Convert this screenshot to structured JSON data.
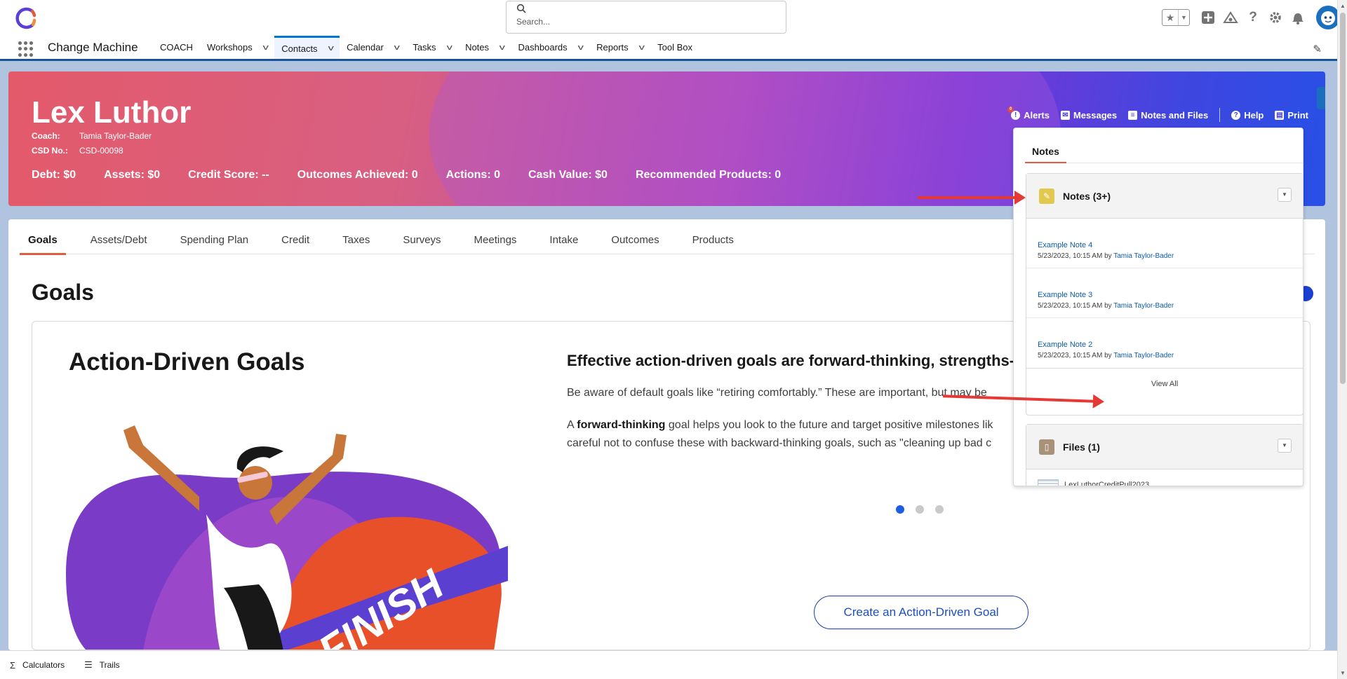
{
  "header": {
    "search_placeholder": "Search..."
  },
  "nav": {
    "app_name": "Change Machine",
    "items": [
      {
        "label": "COACH",
        "has_menu": false
      },
      {
        "label": "Workshops",
        "has_menu": true
      },
      {
        "label": "Contacts",
        "has_menu": true,
        "active": true
      },
      {
        "label": "Calendar",
        "has_menu": true
      },
      {
        "label": "Tasks",
        "has_menu": true
      },
      {
        "label": "Notes",
        "has_menu": true
      },
      {
        "label": "Dashboards",
        "has_menu": true
      },
      {
        "label": "Reports",
        "has_menu": true
      },
      {
        "label": "Tool Box",
        "has_menu": false
      }
    ]
  },
  "contact": {
    "name": "Lex Luthor",
    "coach_label": "Coach:",
    "coach": "Tamia Taylor-Bader",
    "csd_label": "CSD No.:",
    "csd": "CSD-00098",
    "stats": [
      "Debt: $0",
      "Assets: $0",
      "Credit Score: --",
      "Outcomes Achieved: 0",
      "Actions: 0",
      "Cash Value: $0",
      "Recommended Products: 0"
    ]
  },
  "hero_actions": {
    "alerts": "Alerts",
    "alerts_badge": "0",
    "messages": "Messages",
    "notes_files": "Notes and Files",
    "help": "Help",
    "print": "Print"
  },
  "tabs": [
    "Goals",
    "Assets/Debt",
    "Spending Plan",
    "Credit",
    "Taxes",
    "Surveys",
    "Meetings",
    "Intake",
    "Outcomes",
    "Products"
  ],
  "main": {
    "title": "Goals",
    "card_title": "Action-Driven Goals",
    "finish_text": "FINISH",
    "heading": "Effective action-driven goals are forward-thinking, strengths-b",
    "para1": "Be aware of default goals like “retiring comfortably.” These are important, but may be",
    "para2_pre": "A ",
    "para2_bold": "forward-thinking",
    "para2_post": " goal helps you look to the future and target positive milestones lik",
    "para3": "careful not to confuse these with backward-thinking goals, such as \"cleaning up bad c",
    "carousel_pages": 3,
    "carousel_active": 1,
    "create_button": "Create an Action-Driven Goal"
  },
  "panel": {
    "tab": "Notes",
    "notes_section": "Notes (3+)",
    "notes": [
      {
        "title": "Example Note 4",
        "meta": "5/23/2023, 10:15 AM by ",
        "author": "Tamia Taylor-Bader"
      },
      {
        "title": "Example Note 3",
        "meta": "5/23/2023, 10:15 AM by ",
        "author": "Tamia Taylor-Bader"
      },
      {
        "title": "Example Note 2",
        "meta": "5/23/2023, 10:15 AM by ",
        "author": "Tamia Taylor-Bader"
      }
    ],
    "view_all": "View All",
    "files_section": "Files (1)",
    "files": [
      {
        "name": "LexLuthorCreditPull2023"
      }
    ]
  },
  "utility": {
    "calculators": "Calculators",
    "trails": "Trails"
  },
  "colors": {
    "brand_blue": "#0176d3",
    "accent_orange": "#e35a43",
    "arrow_red": "#e53935",
    "link_blue": "#0b5cab"
  }
}
